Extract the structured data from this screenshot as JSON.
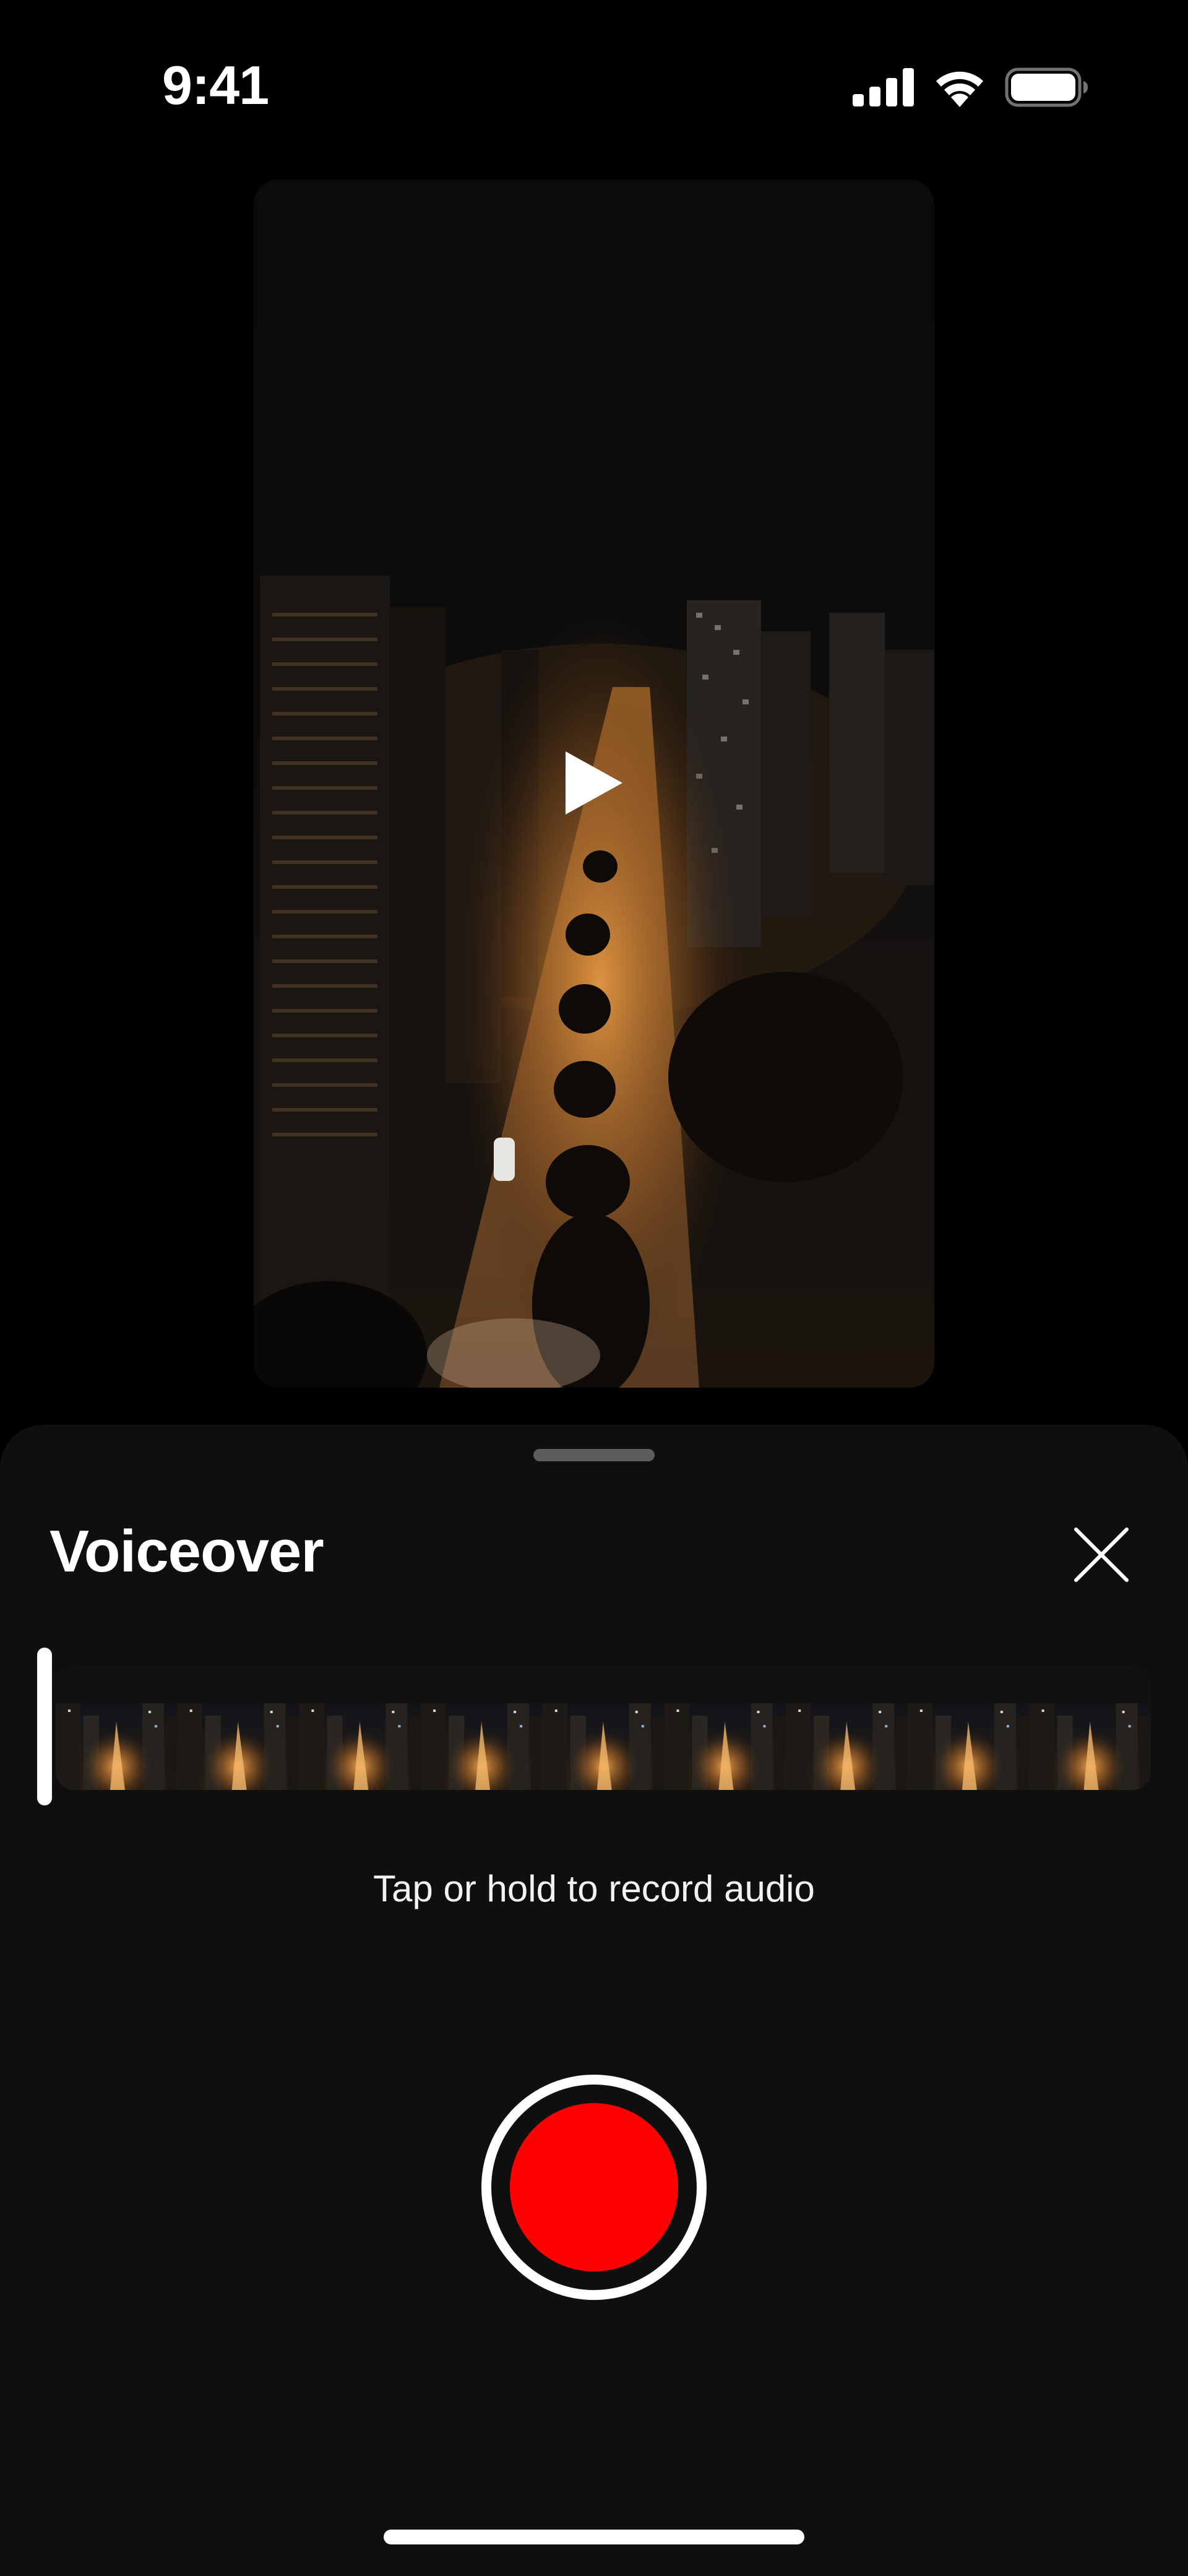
{
  "status_bar": {
    "time": "9:41",
    "icons": [
      "cellular-signal-icon",
      "wifi-icon",
      "battery-icon"
    ]
  },
  "video": {
    "state": "paused",
    "play_icon": "play-icon"
  },
  "sheet": {
    "title": "Voiceover",
    "close_icon": "close-icon",
    "hint": "Tap or hold to record audio",
    "record_color": "#ff0000",
    "filmstrip_frames": 9,
    "playhead_position": 0
  },
  "colors": {
    "background": "#000000",
    "sheet": "#0f0f0f",
    "record": "#ff0000",
    "accent_light": "#e8a04a"
  }
}
